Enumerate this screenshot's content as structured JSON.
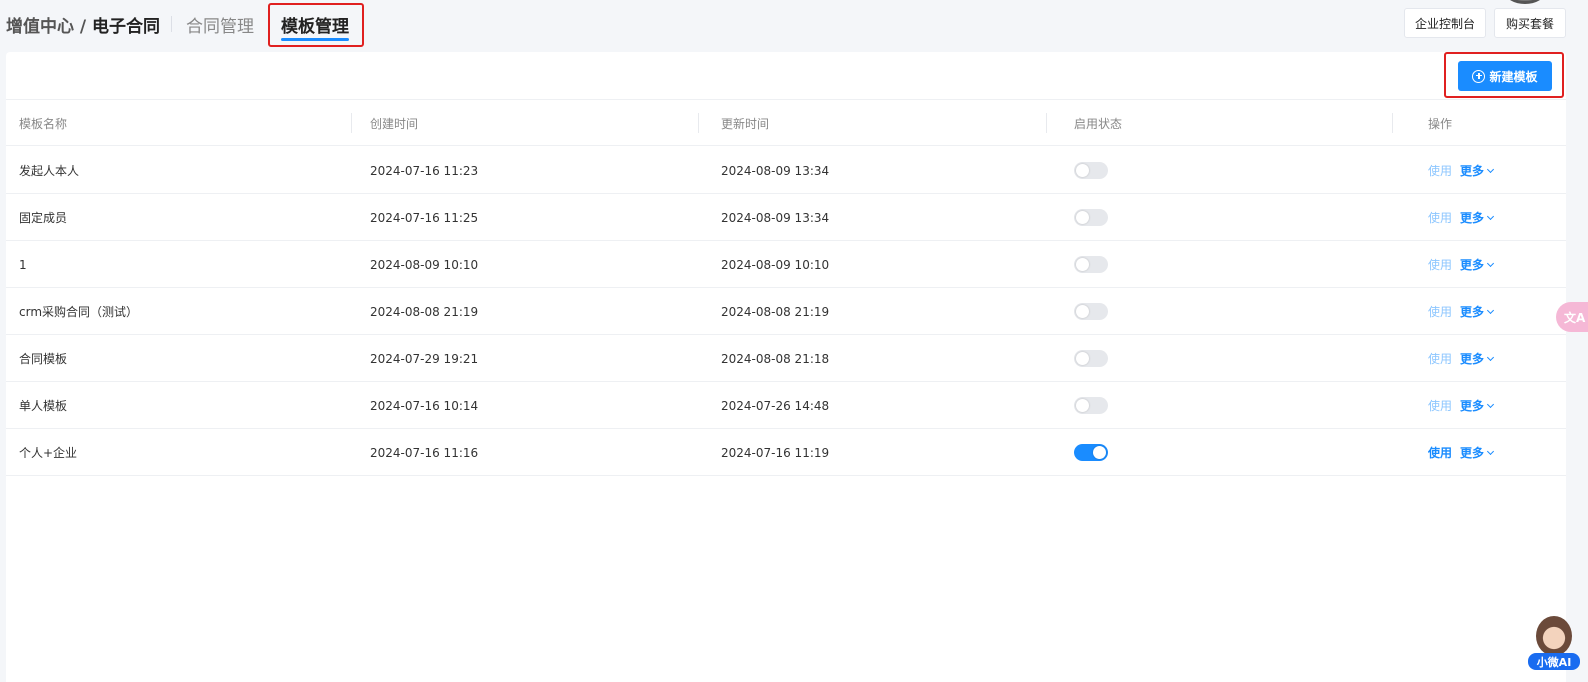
{
  "header": {
    "breadcrumb_root": "增值中心 / ",
    "breadcrumb_current": "电子合同",
    "tabs": [
      {
        "label": "合同管理"
      },
      {
        "label": "模板管理"
      }
    ],
    "console_button": "企业控制台",
    "buy_button": "购买套餐"
  },
  "toolbar": {
    "new_template_button": "新建模板"
  },
  "table": {
    "columns": [
      "模板名称",
      "创建时间",
      "更新时间",
      "启用状态",
      "操作"
    ],
    "rows": [
      {
        "name": "发起人本人",
        "created": "2024-07-16 11:23",
        "updated": "2024-08-09 13:34",
        "enabled": false,
        "use": "使用",
        "more": "更多"
      },
      {
        "name": "固定成员",
        "created": "2024-07-16 11:25",
        "updated": "2024-08-09 13:34",
        "enabled": false,
        "use": "使用",
        "more": "更多"
      },
      {
        "name": "1",
        "created": "2024-08-09 10:10",
        "updated": "2024-08-09 10:10",
        "enabled": false,
        "use": "使用",
        "more": "更多"
      },
      {
        "name": "crm采购合同（测试）",
        "created": "2024-08-08 21:19",
        "updated": "2024-08-08 21:19",
        "enabled": false,
        "use": "使用",
        "more": "更多"
      },
      {
        "name": "合同模板",
        "created": "2024-07-29 19:21",
        "updated": "2024-08-08 21:18",
        "enabled": false,
        "use": "使用",
        "more": "更多"
      },
      {
        "name": "单人模板",
        "created": "2024-07-16 10:14",
        "updated": "2024-07-26 14:48",
        "enabled": false,
        "use": "使用",
        "more": "更多"
      },
      {
        "name": "个人+企业",
        "created": "2024-07-16 11:16",
        "updated": "2024-07-16 11:19",
        "enabled": true,
        "use": "使用",
        "more": "更多"
      }
    ]
  },
  "floating": {
    "translate_label": "文A",
    "ai_label": "小微AI"
  },
  "colors": {
    "accent": "#1a8cff",
    "highlight": "#e02020"
  }
}
